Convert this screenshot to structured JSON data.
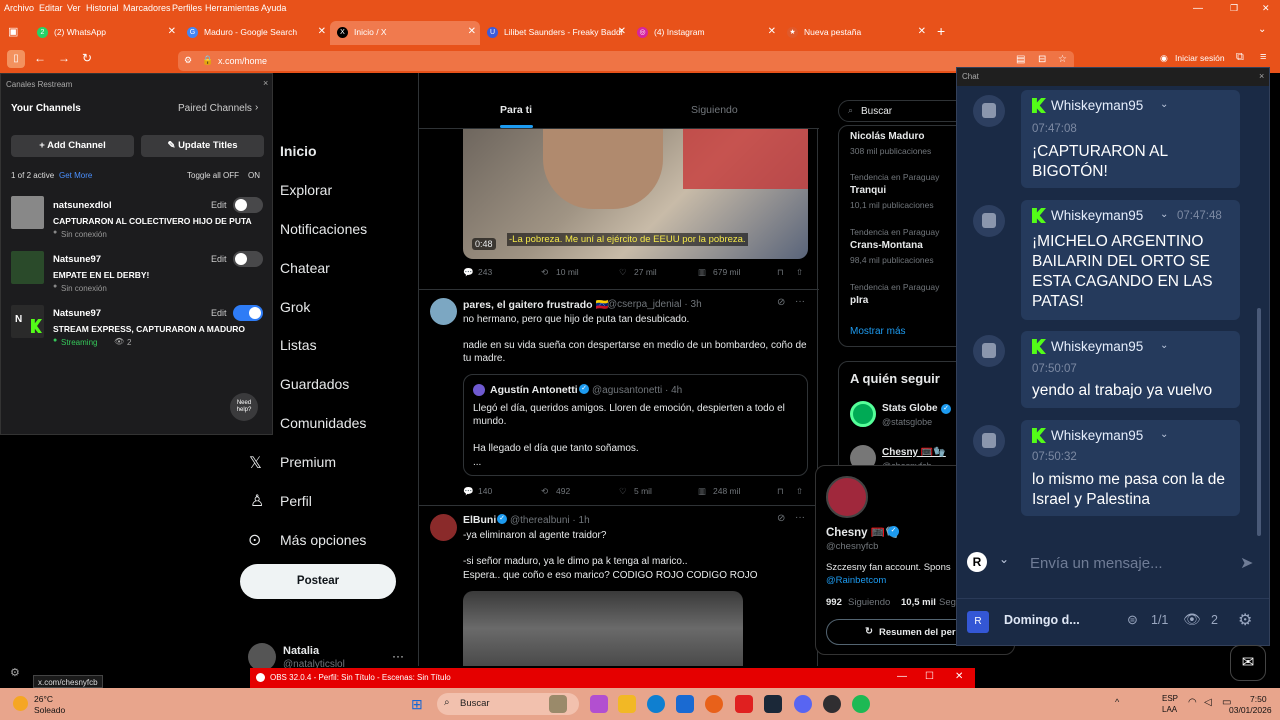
{
  "menu": [
    "Archivo",
    "Editar",
    "Ver",
    "Historial",
    "Marcadores",
    "Perfiles",
    "Herramientas",
    "Ayuda"
  ],
  "tabs": [
    {
      "label": "(2) WhatsApp",
      "icon": "2",
      "color": "#25d366"
    },
    {
      "label": "Maduro - Google Search",
      "icon": "G",
      "color": "#4285f4"
    },
    {
      "label": "Inicio / X",
      "icon": "X",
      "color": "#000000"
    },
    {
      "label": "Lilibet Saunders - Freaky Baddi",
      "icon": "U",
      "color": "#3b5bdb"
    },
    {
      "label": "(4) Instagram",
      "icon": "◎",
      "color": "#d6249f"
    },
    {
      "label": "Nueva pestaña",
      "icon": "★",
      "color": "#e05a2b"
    }
  ],
  "url": "x.com/home",
  "signin": "Iniciar sesión",
  "restream": {
    "title": "Canales Restream",
    "your_channels": "Your Channels",
    "paired": "Paired Channels",
    "add": "Add Channel",
    "update": "Update Titles",
    "active": "1 of 2 active",
    "get_more": "Get More",
    "toggle_all": "Toggle all OFF",
    "on": "ON",
    "edit": "Edit",
    "need_help": "Need help?",
    "channels": [
      {
        "name": "natsunexdlol",
        "title": "CAPTURARON AL COLECTIVERO HIJO DE PUTA",
        "status": "Sin conexión",
        "on": false
      },
      {
        "name": "Natsune97",
        "title": "EMPATE EN EL DERBY!",
        "status": "Sin conexión",
        "on": false
      },
      {
        "name": "Natsune97",
        "title": "STREAM EXPRESS, CAPTURARON A MADURO",
        "status": "Streaming",
        "viewers": "2",
        "on": true
      }
    ]
  },
  "x": {
    "nav": [
      "Inicio",
      "Explorar",
      "Notificaciones",
      "Chatear",
      "Grok",
      "Listas",
      "Guardados",
      "Comunidades",
      "Premium",
      "Perfil",
      "Más opciones"
    ],
    "post_button": "Postear",
    "user_name": "Natalia",
    "user_handle": "@natalyticslol",
    "tabs": [
      "Para ti",
      "Siguiendo"
    ],
    "video_time": "0:48",
    "video_caption": "-La pobreza. Me uní al ejército de EEUU por la pobreza.",
    "t0_stats": [
      "243",
      "10 mil",
      "27 mil",
      "679 mil"
    ],
    "t1": {
      "name": "pares, el gaitero frustrado 🇻🇪",
      "handle": "@cserpa_jdenial · 3h",
      "text1": "no hermano, pero que hijo de puta tan desubicado.",
      "text2": "nadie en su vida sueña con despertarse en medio de un bombardeo, coño de tu madre.",
      "quote_name": "Agustín Antonetti",
      "quote_handle": "@agusantonetti · 4h",
      "quote1": "Llegó el día, queridos amigos. Lloren de emoción, despierten a todo el mundo.",
      "quote2": "Ha llegado el día que tanto soñamos.",
      "quote3": "...",
      "stats": [
        "140",
        "492",
        "5 mil",
        "248 mil"
      ]
    },
    "t2": {
      "name": "ElBuni",
      "handle": "@therealbuni · 1h",
      "text1": "-ya eliminaron al agente traidor?",
      "text2": "-si señor maduro, ya le dimo pa k tenga al marico..",
      "text3": "Espera.. que coño e eso marico? CODIGO ROJO CODIGO ROJO"
    },
    "search": "Buscar",
    "trends": [
      {
        "context": "",
        "name": "Nicolás Maduro",
        "count": "308 mil publicaciones"
      },
      {
        "context": "Tendencia en Paraguay",
        "name": "Tranqui",
        "count": "10,1 mil publicaciones"
      },
      {
        "context": "Tendencia en Paraguay",
        "name": "Crans-Montana",
        "count": "98,4 mil publicaciones"
      },
      {
        "context": "Tendencia en Paraguay",
        "name": "pIra",
        "count": ""
      }
    ],
    "show_more": "Mostrar más",
    "who_to_follow": "A quién seguir",
    "follow": [
      {
        "name": "Stats Globe",
        "handle": "@statsglobe"
      },
      {
        "name": "Chesny 🥅🧤",
        "handle": "@chesnyfcb"
      }
    ],
    "popup": {
      "name": "Chesny 🥅🧤",
      "handle": "@chesnyfcb",
      "bio": "Szczesny fan account. Spons",
      "bio_link": "@Rainbetcom",
      "following": "992",
      "following_label": "Siguiendo",
      "followers": "10,5 mil",
      "followers_label": "Seg",
      "button": "Resumen del per"
    }
  },
  "chat": {
    "title": "Chat",
    "messages": [
      {
        "user": "Whiskeyman95",
        "time": "07:47:08",
        "text": "¡CAPTURARON AL BIGOTÓN!"
      },
      {
        "user": "Whiskeyman95",
        "time": "07:47:48",
        "text": "¡MICHELO ARGENTINO BAILARIN DEL ORTO SE ESTA CAGANDO EN LAS PATAS!"
      },
      {
        "user": "Whiskeyman95",
        "time": "07:50:07",
        "text": "yendo al trabajo ya vuelvo"
      },
      {
        "user": "Whiskeyman95",
        "time": "07:50:32",
        "text": "lo mismo me pasa con la de Israel y Palestina"
      }
    ],
    "placeholder": "Envía un mensaje...",
    "event": "Domingo d...",
    "sources": "1/1",
    "viewers": "2"
  },
  "status_url": "x.com/chesnyfcb",
  "obs": "OBS 32.0.4 - Perfil: Sin Título - Escenas: Sin Título",
  "weather": {
    "temp": "26°C",
    "desc": "Soleado"
  },
  "taskbar_search": "Buscar",
  "lang": {
    "l1": "ESP",
    "l2": "LAA"
  },
  "clock": {
    "time": "7:50",
    "date": "03/01/2026"
  }
}
